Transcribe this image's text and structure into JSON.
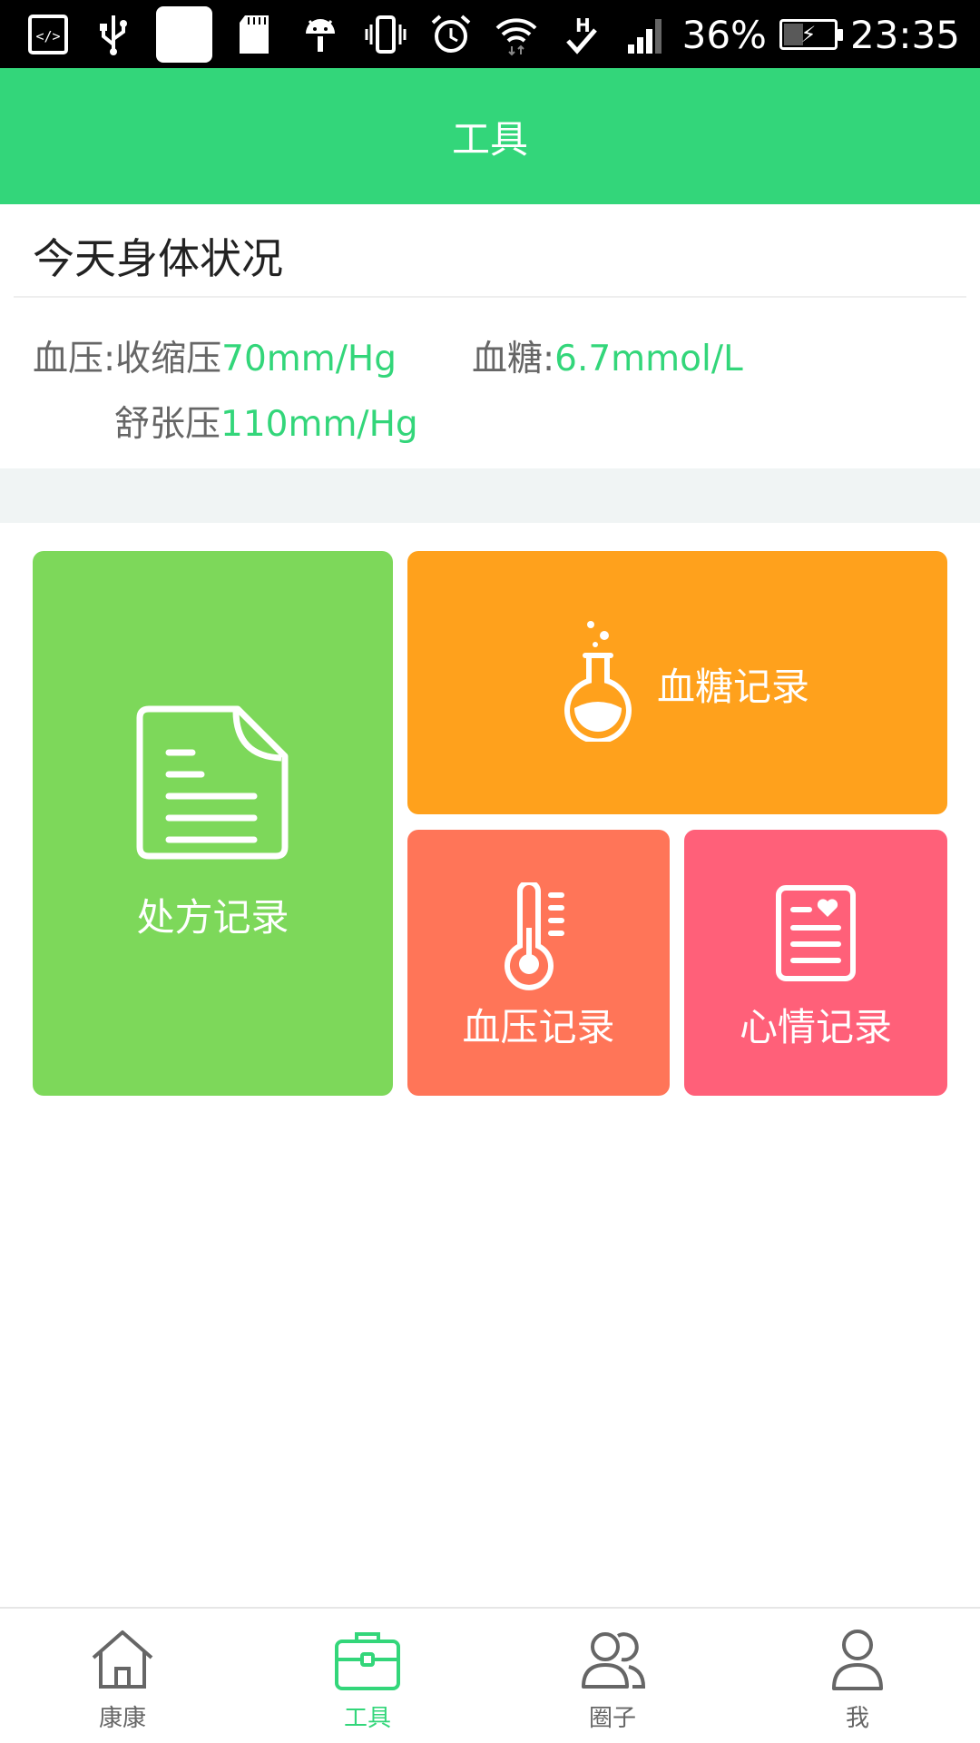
{
  "status_bar": {
    "battery": "36%",
    "battery_level": 0.36,
    "time": "23:35",
    "icons": [
      "code-icon",
      "usb-icon",
      "notification-icon",
      "sd-card-icon",
      "android-icon",
      "vibrate-icon",
      "alarm-icon",
      "wifi-icon",
      "network-h-icon",
      "signal-icon",
      "battery-charging-icon"
    ]
  },
  "header": {
    "title": "工具"
  },
  "health": {
    "title": "今天身体状况",
    "bp_label": "血压:收缩压",
    "bp_systolic": "70mm/Hg",
    "diastolic_label": "舒张压",
    "bp_diastolic": "110mm/Hg",
    "sugar_label": "血糖:",
    "sugar_value": "6.7mmol/L"
  },
  "tiles": {
    "prescription": {
      "label": "处方记录",
      "color": "#7dd85a",
      "icon": "document-icon"
    },
    "blood_sugar": {
      "label": "血糖记录",
      "color": "#ffa11c",
      "icon": "flask-icon"
    },
    "blood_pressure": {
      "label": "血压记录",
      "color": "#ff7558",
      "icon": "thermometer-icon"
    },
    "mood": {
      "label": "心情记录",
      "color": "#ff6079",
      "icon": "heart-notebook-icon"
    }
  },
  "nav": {
    "items": [
      {
        "label": "康康",
        "icon": "home-icon",
        "active": false
      },
      {
        "label": "工具",
        "icon": "toolbox-icon",
        "active": true
      },
      {
        "label": "圈子",
        "icon": "group-icon",
        "active": false
      },
      {
        "label": "我",
        "icon": "person-icon",
        "active": false
      }
    ]
  },
  "colors": {
    "accent": "#33d67a",
    "background_band": "#f0f4f4"
  }
}
